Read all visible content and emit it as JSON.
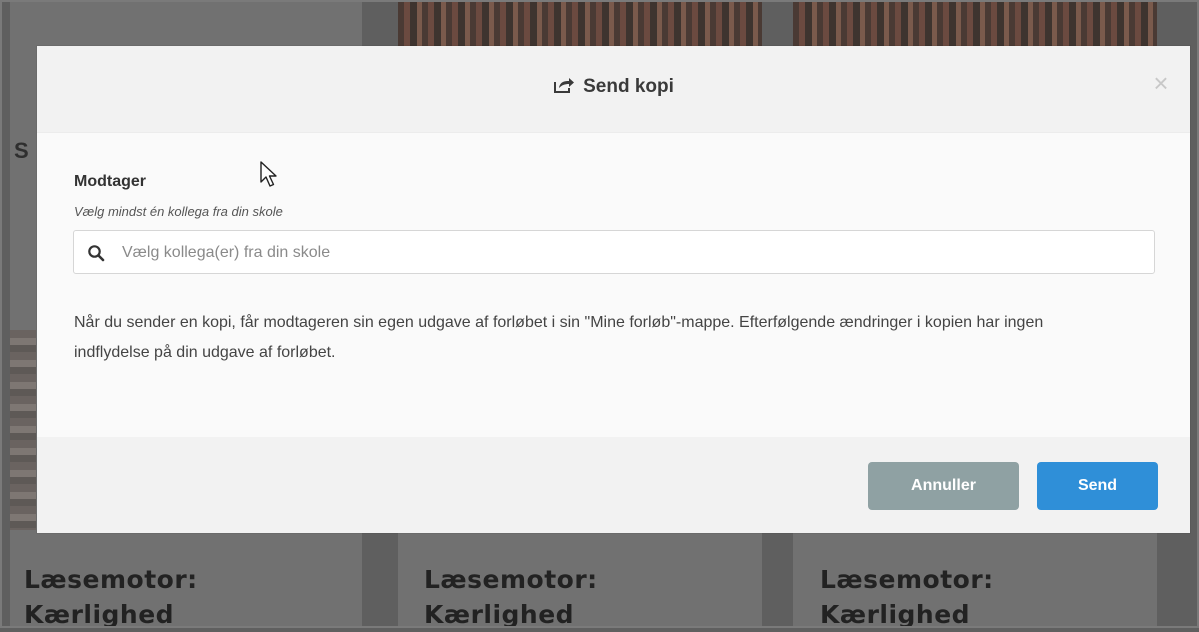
{
  "modal": {
    "title": "Send kopi",
    "title_icon": "share-icon",
    "close_icon": "close-icon",
    "close_glyph": "×",
    "recipient_label": "Modtager",
    "recipient_hint": "Vælg mindst én kollega fra din skole",
    "search": {
      "icon": "search-icon",
      "placeholder": "Vælg kollega(er) fra din skole",
      "value": ""
    },
    "info_text": "Når du sender en kopi, får modtageren sin egen udgave af forløbet i sin \"Mine forløb\"-mappe. Efterfølgende ændringer i kopien har ingen indflydelse på din udgave af forløbet.",
    "buttons": {
      "cancel": "Annuller",
      "send": "Send"
    },
    "colors": {
      "send_button": "#2f8fd8",
      "cancel_button": "#8fa1a3"
    }
  },
  "background": {
    "left_letter": "S",
    "cards": [
      {
        "line1": "Læsemotor:",
        "line2": "Kærlighed"
      },
      {
        "line1": "Læsemotor:",
        "line2": "Kærlighed"
      },
      {
        "line1": "Læsemotor:",
        "line2": "Kærlighed"
      }
    ]
  }
}
